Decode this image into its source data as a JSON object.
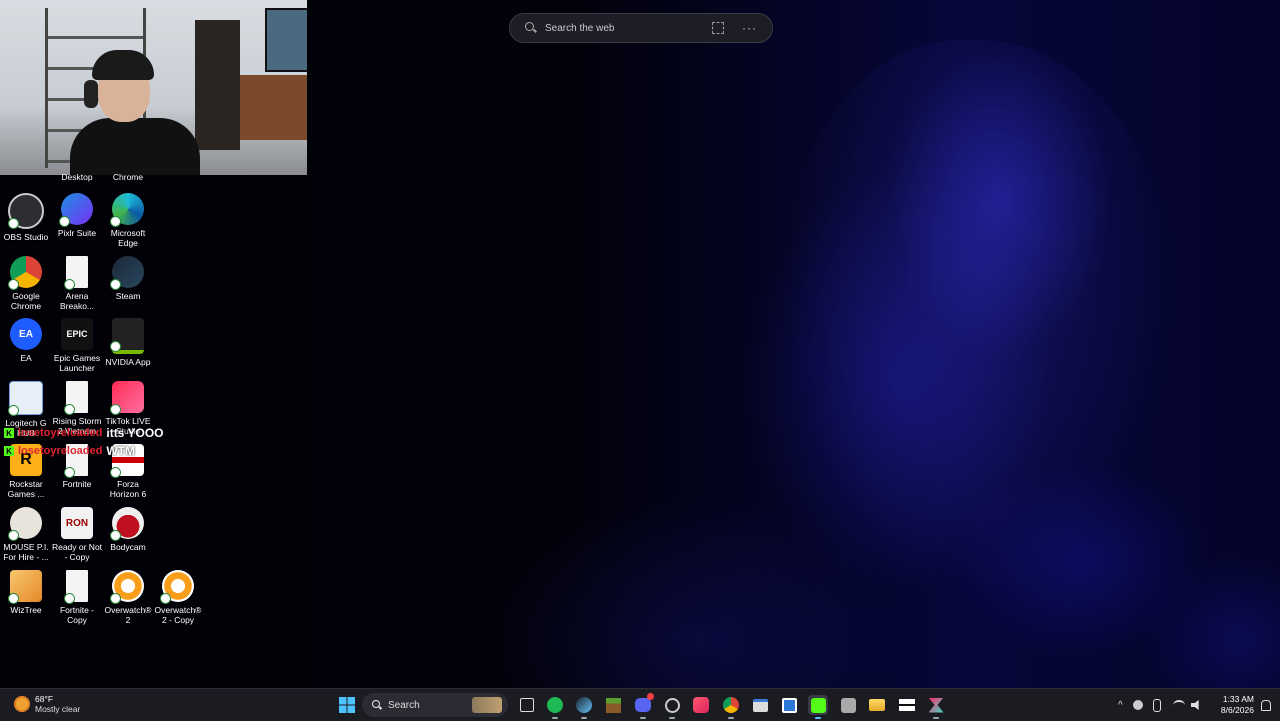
{
  "search_bar": {
    "placeholder": "Search the web",
    "more": "···"
  },
  "desktop_icons": [
    {
      "id": "desktop",
      "label": "Desktop",
      "icon": "desktop-icon"
    },
    {
      "id": "chrome-top",
      "label": "Chrome",
      "icon": "chrome-icon"
    },
    {
      "id": "obs",
      "label": "OBS Studio",
      "icon": "obs-icon"
    },
    {
      "id": "pixlr",
      "label": "Pixlr Suite",
      "icon": "pixlr-icon"
    },
    {
      "id": "edge",
      "label": "Microsoft Edge",
      "icon": "edge-icon"
    },
    {
      "id": "chrome",
      "label": "Google Chrome",
      "icon": "chrome-icon"
    },
    {
      "id": "arena",
      "label": "Arena Breako...",
      "icon": "file-icon"
    },
    {
      "id": "steam",
      "label": "Steam",
      "icon": "steam-icon"
    },
    {
      "id": "ea",
      "label": "EA",
      "icon": "ea-icon",
      "glyph": "EA"
    },
    {
      "id": "epic",
      "label": "Epic Games Launcher",
      "icon": "epic-games-icon",
      "glyph": "EPIC"
    },
    {
      "id": "nvidia",
      "label": "NVIDIA App",
      "icon": "nvidia-icon"
    },
    {
      "id": "logitech",
      "label": "Logitech G HUB",
      "icon": "logitech-icon"
    },
    {
      "id": "rising",
      "label": "Rising Storm 2 Vietnam",
      "icon": "file-icon"
    },
    {
      "id": "tiktok",
      "label": "TikTok LIVE Studio",
      "icon": "tiktok-icon"
    },
    {
      "id": "rockstar",
      "label": "Rockstar Games ...",
      "icon": "rockstar-icon",
      "glyph": "R"
    },
    {
      "id": "fortnite",
      "label": "Fortnite",
      "icon": "file-icon"
    },
    {
      "id": "forza",
      "label": "Forza Horizon 6",
      "icon": "forza-icon"
    },
    {
      "id": "mouse",
      "label": "MOUSE P.I. For Hire - ...",
      "icon": "mouse-pi-icon"
    },
    {
      "id": "ready",
      "label": "Ready or Not - Copy",
      "icon": "ready-or-not-icon",
      "glyph": "RON"
    },
    {
      "id": "bodycam",
      "label": "Bodycam",
      "icon": "bodycam-icon"
    },
    {
      "id": "wiztree",
      "label": "WizTree",
      "icon": "wiztree-icon"
    },
    {
      "id": "fortnite-copy",
      "label": "Fortnite - Copy",
      "icon": "file-icon"
    },
    {
      "id": "ow2",
      "label": "Overwatch® 2",
      "icon": "overwatch-icon"
    },
    {
      "id": "ow2-copy",
      "label": "Overwatch® 2 - Copy",
      "icon": "overwatch-icon"
    }
  ],
  "chat": [
    {
      "badge": "K",
      "user": "losetoyreloaded",
      "message": "itts YOOO"
    },
    {
      "badge": "K",
      "user": "losetoyreloaded",
      "message": "WTM"
    }
  ],
  "taskbar": {
    "weather": {
      "temp": "68°F",
      "condition": "Mostly clear"
    },
    "search_label": "Search",
    "pinned": [
      "start-icon",
      "search",
      "task-view-icon",
      "spotify-icon",
      "steam-icon",
      "minecraft-icon",
      "discord-icon",
      "obs-icon",
      "itunes-icon",
      "chrome-icon",
      "app-icon",
      "app-icon",
      "kick-app-icon",
      "app-icon",
      "file-explorer-icon",
      "forza-icon",
      "capcut-icon"
    ],
    "clock": {
      "time": "1:33 AM",
      "date": "8/6/2026"
    }
  }
}
